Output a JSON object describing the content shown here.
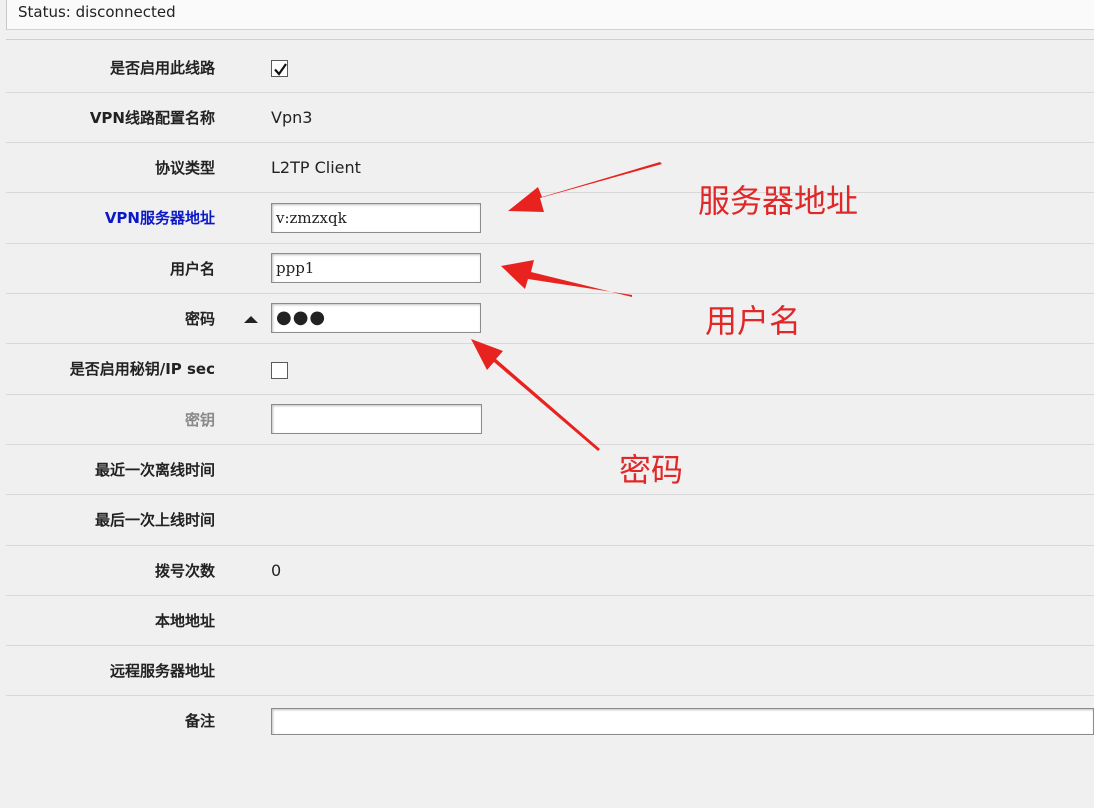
{
  "status": {
    "text": "Status: disconnected"
  },
  "form": {
    "enable_line": {
      "label": "是否启用此线路",
      "checked": true
    },
    "config_name": {
      "label": "VPN线路配置名称",
      "value": "Vpn3"
    },
    "protocol": {
      "label": "协议类型",
      "value": "L2TP Client"
    },
    "server_address": {
      "label": "VPN服务器地址",
      "value": "v:zmzxqk"
    },
    "username": {
      "label": "用户名",
      "value": "ppp1"
    },
    "password": {
      "label": "密码",
      "value": "●●●"
    },
    "enable_secret": {
      "label": "是否启用秘钥/IP sec",
      "checked": false
    },
    "secret_key": {
      "label": "密钥",
      "value": ""
    },
    "last_offline": {
      "label": "最近一次离线时间",
      "value": ""
    },
    "last_online": {
      "label": "最后一次上线时间",
      "value": ""
    },
    "dial_count": {
      "label": "拨号次数",
      "value": "0"
    },
    "local_address": {
      "label": "本地地址",
      "value": ""
    },
    "remote_address": {
      "label": "远程服务器地址",
      "value": ""
    },
    "remark": {
      "label": "备注",
      "value": ""
    }
  },
  "annotations": {
    "server": "服务器地址",
    "username": "用户名",
    "password": "密码"
  },
  "colors": {
    "annotation": "#e02828",
    "link_label": "#0b18c8"
  }
}
